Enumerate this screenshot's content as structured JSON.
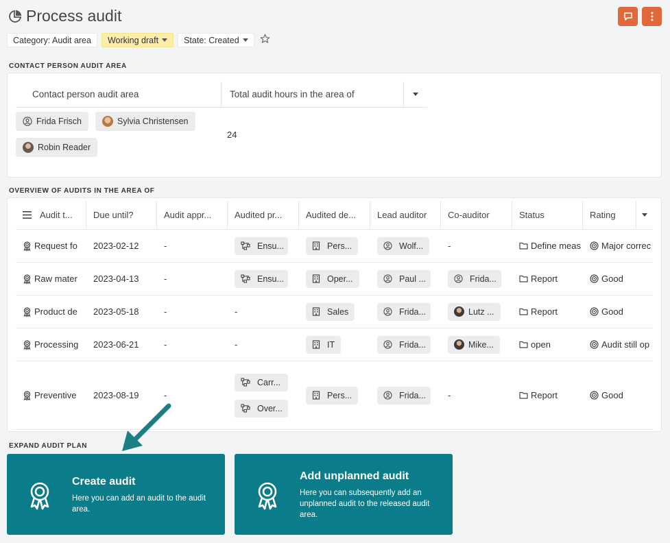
{
  "header": {
    "title": "Process audit"
  },
  "tags": [
    {
      "label": "Category: Audit area"
    },
    {
      "label": "Working draft"
    },
    {
      "label": "State: Created"
    }
  ],
  "sections": {
    "contact": "CONTACT PERSON AUDIT AREA",
    "overview": "OVERVIEW OF AUDITS IN THE AREA OF",
    "expand": "EXPAND AUDIT PLAN"
  },
  "contact_table": {
    "headers": [
      "Contact person audit area",
      "Total audit hours in the area of"
    ],
    "people": [
      "Frida Frisch",
      "Sylvia Christensen",
      "Robin Reader"
    ],
    "hours": "24"
  },
  "audits": {
    "headers": [
      "Audit t...",
      "Due until?",
      "Audit appr...",
      "Audited pr...",
      "Audited de...",
      "Lead auditor",
      "Co-auditor",
      "Status",
      "Rating"
    ],
    "rows": [
      {
        "topic": "Request fo",
        "due": "2023-02-12",
        "approval": "-",
        "process": [
          "Ensu..."
        ],
        "dept": "Pers...",
        "lead": "Wolf...",
        "co": "-",
        "co_avatar": "",
        "status": "Define meas",
        "rating": "Major correc"
      },
      {
        "topic": "Raw mater",
        "due": "2023-04-13",
        "approval": "-",
        "process": [
          "Ensu..."
        ],
        "dept": "Oper...",
        "lead": "Paul ...",
        "co": "Frida...",
        "co_avatar": "user",
        "status": "Report",
        "rating": "Good"
      },
      {
        "topic": "Product de",
        "due": "2023-05-18",
        "approval": "-",
        "process": [],
        "process_empty": "-",
        "dept": "Sales",
        "lead": "Frida...",
        "co": "Lutz ...",
        "co_avatar": "photo",
        "status": "Report",
        "rating": "Good"
      },
      {
        "topic": "Processing",
        "due": "2023-06-21",
        "approval": "-",
        "process": [],
        "process_empty": "-",
        "dept": "IT",
        "lead": "Frida...",
        "co": "Mike...",
        "co_avatar": "photo",
        "status": "open",
        "rating": "Audit still op"
      },
      {
        "topic": "Preventive",
        "due": "2023-08-19",
        "approval": "-",
        "process": [
          "Carr...",
          "Over..."
        ],
        "dept": "Pers...",
        "lead": "Frida...",
        "co": "-",
        "co_avatar": "",
        "status": "Report",
        "rating": "Good"
      }
    ]
  },
  "tiles": [
    {
      "title": "Create audit",
      "desc": "Here you can add an audit to the audit area."
    },
    {
      "title": "Add unplanned audit",
      "desc": "Here you can subsequently add an unplanned audit to the released audit area."
    }
  ],
  "colors": {
    "accent": "#0a7c8a",
    "orange": "#e0683a",
    "draft": "#fbeeaa"
  }
}
